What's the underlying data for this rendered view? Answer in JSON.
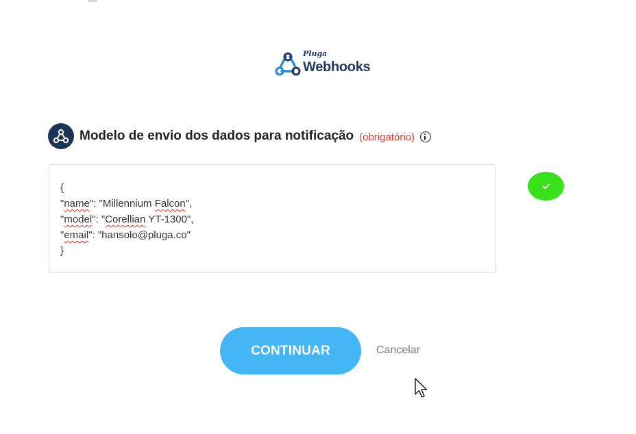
{
  "header": {
    "logo_brand": "Pluga",
    "logo_product": "Webhooks"
  },
  "section": {
    "title": "Modelo de envio dos dados para notificação",
    "required_label": "(obrigatório)",
    "info_icon": "info-icon",
    "avatar_icon": "webhook-icon"
  },
  "payload": {
    "lines": [
      "{",
      "\"name\": \"Millennium Falcon\",",
      "\"model\": \"Corellian YT-1300\",",
      "\"email\": \"hansolo@pluga.co\"",
      "}"
    ],
    "parts": {
      "q": "\"",
      "name_key": "name",
      "name_sep": "\": \"Millennium ",
      "name_val_flag": "Falcon",
      "name_end": "\",",
      "model_key": "model",
      "model_sep": "\": \"",
      "model_val_flag": "Corellian",
      "model_end": " YT-1300\",",
      "email_key": "email",
      "email_end": "\": \"hansolo@pluga.co\""
    }
  },
  "status": {
    "icon": "check-icon",
    "color": "#3ae01a"
  },
  "actions": {
    "continue_label": "CONTINUAR",
    "cancel_label": "Cancelar"
  },
  "colors": {
    "accent": "#45b6f5",
    "required": "#d9382d",
    "brand_navy": "#1c3554"
  }
}
